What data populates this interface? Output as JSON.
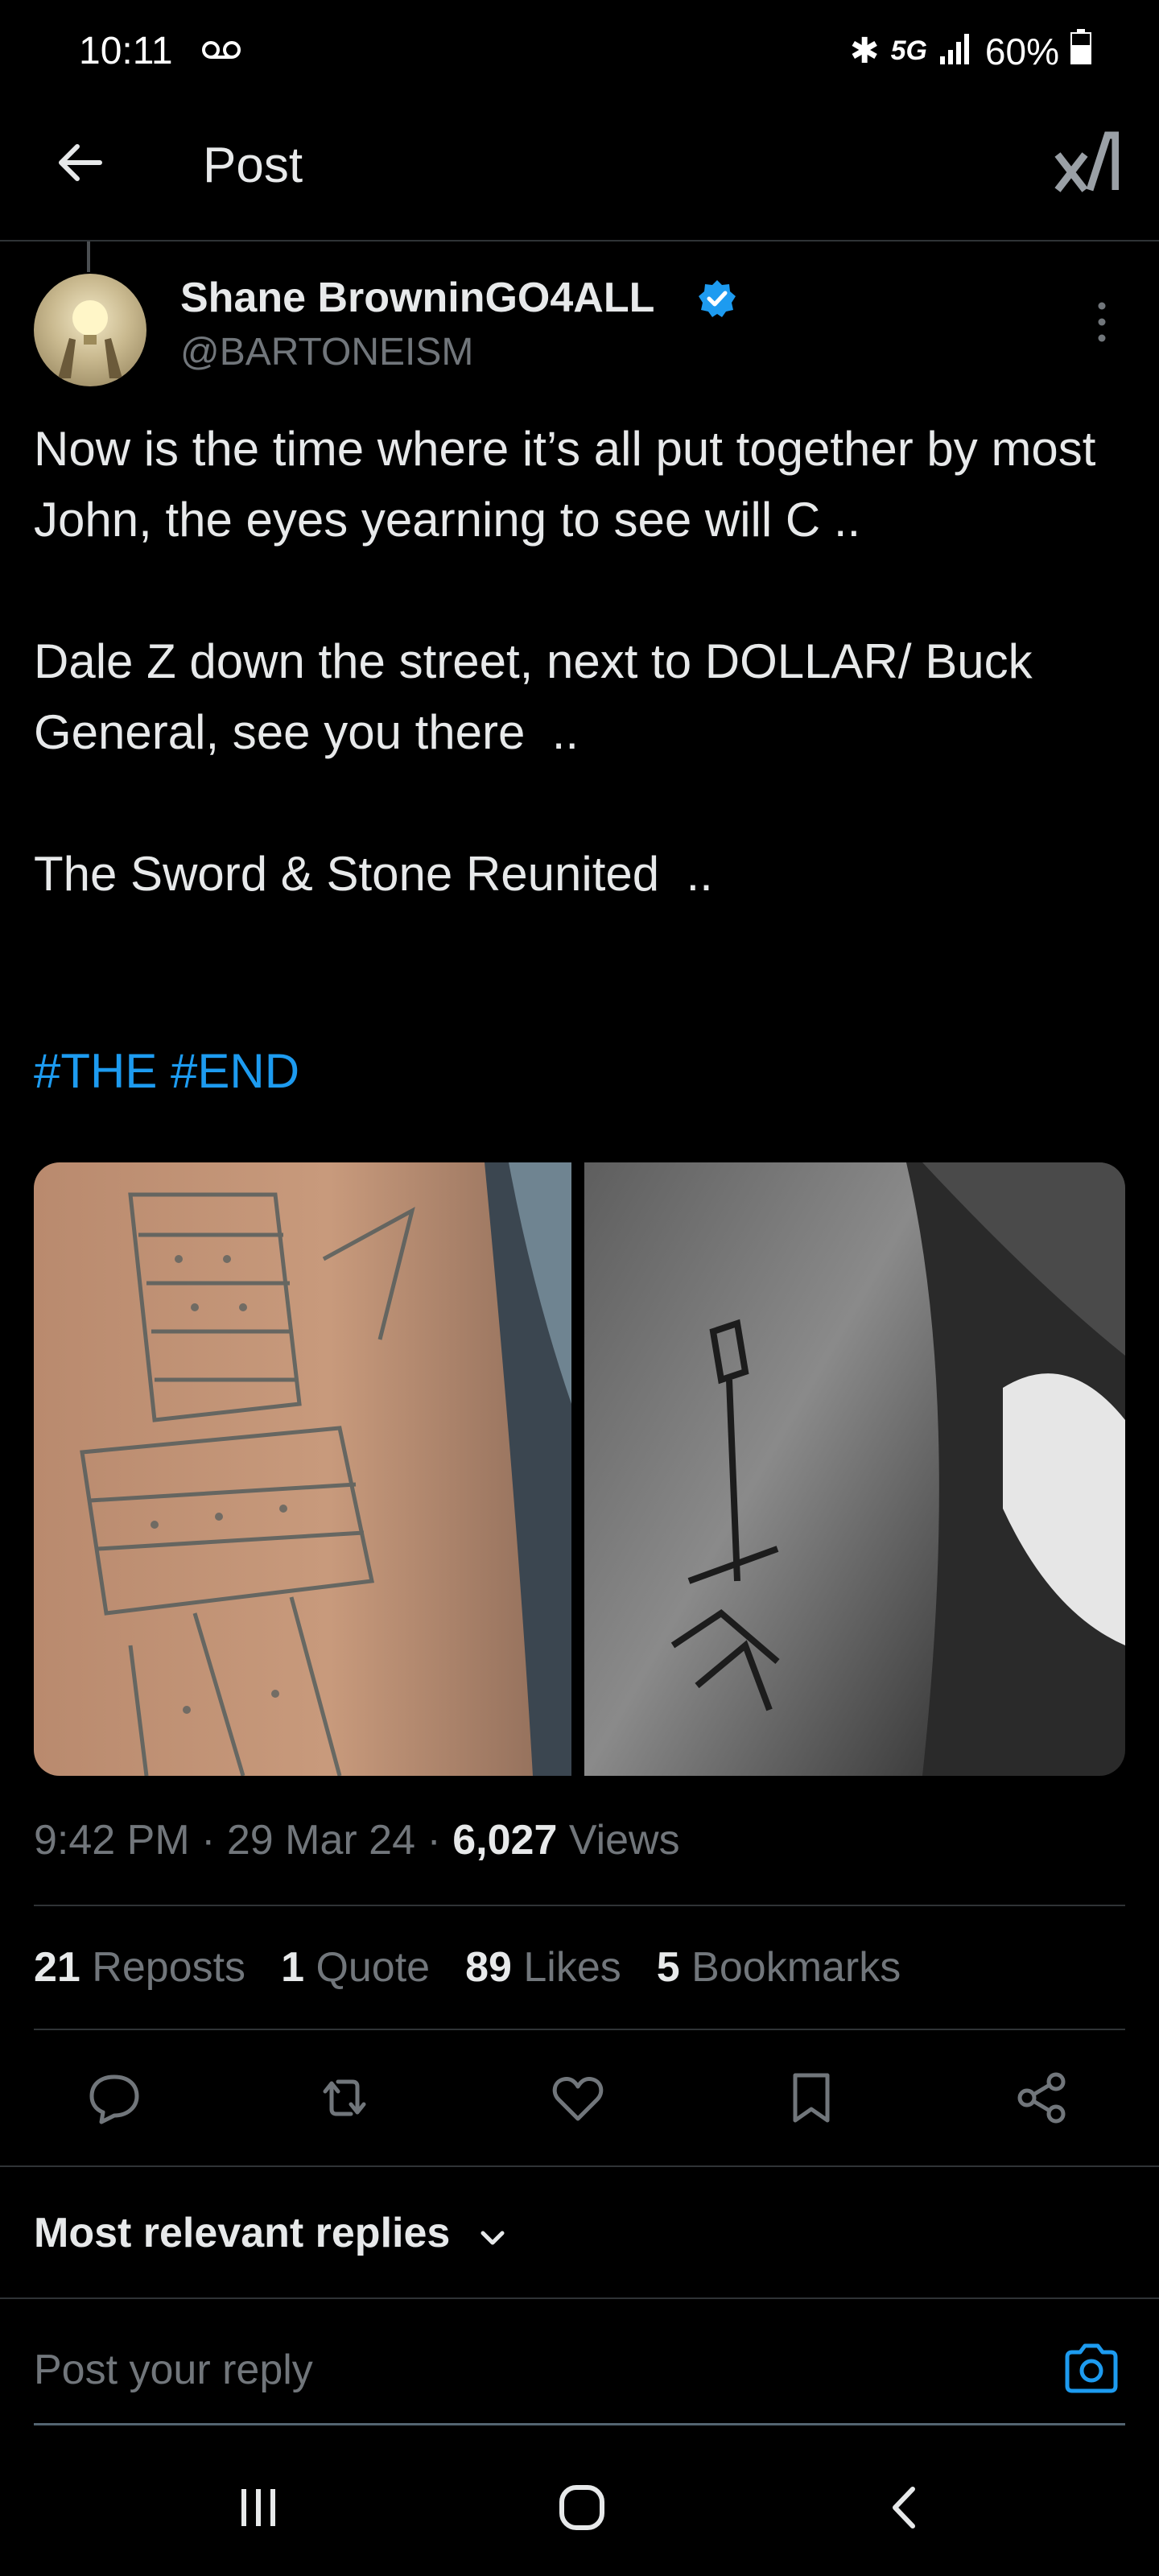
{
  "status_bar": {
    "time": "10:11",
    "network": "5G",
    "battery": "60%"
  },
  "header": {
    "title": "Post"
  },
  "author": {
    "name": "Shane BrowninGO4ALL",
    "handle": "@BARTONEISM"
  },
  "post": {
    "text": "Now is the time where it’s all put together by most John, the eyes yearning to see will C ..\n\nDale Z down the street, next to DOLLAR/ Buck General, see you there  ..\n\nThe Sword & Stone Reunited  ..",
    "hashtags": "#THE #END"
  },
  "meta": {
    "time": "9:42 PM",
    "date": "29 Mar 24",
    "views_count": "6,027",
    "views_label": "Views"
  },
  "stats": {
    "reposts_count": "21",
    "reposts_label": "Reposts",
    "quotes_count": "1",
    "quotes_label": "Quote",
    "likes_count": "89",
    "likes_label": "Likes",
    "bookmarks_count": "5",
    "bookmarks_label": "Bookmarks"
  },
  "replies": {
    "sort_label": "Most relevant replies",
    "reply_placeholder": "Post your reply"
  },
  "colors": {
    "accent": "#1d9bf0",
    "background": "#000000",
    "muted": "#71767b"
  },
  "icons": [
    "back-arrow-icon",
    "brand-logo-icon",
    "verified-badge-icon",
    "more-icon",
    "reply-icon",
    "repost-icon",
    "like-icon",
    "bookmark-icon",
    "share-icon",
    "chevron-down-icon",
    "camera-icon"
  ]
}
